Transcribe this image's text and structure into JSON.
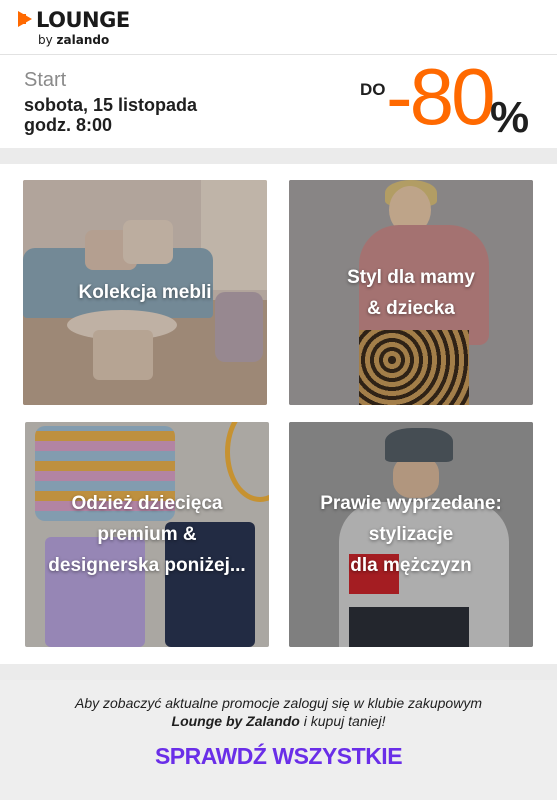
{
  "header": {
    "brand": "LOUNGE",
    "brand_sub_prefix": "by ",
    "brand_sub_name": "zalando",
    "brand_color": "#ff6900"
  },
  "event": {
    "start_label": "Start",
    "date": "sobota, 15 listopada",
    "time": "godz. 8:00",
    "discount_prefix": "DO",
    "discount_value": "-80",
    "discount_unit": "%",
    "accent_color": "#ff6900"
  },
  "tiles": [
    {
      "label": "Kolekcja mebli"
    },
    {
      "label": "Styl dla mamy\n& dziecka"
    },
    {
      "label": "Odzież dziecięca\npremium &\ndesignerska poniżej..."
    },
    {
      "label": "Prawie wyprzedane:\nstylizacje\ndla mężczyzn"
    }
  ],
  "footer": {
    "text_line1": "Aby zobaczyć aktualne promocje zaloguj się w klubie zakupowym",
    "text_line2_bold": "Lounge by Zalando",
    "text_line2_rest": " i kupuj taniej!",
    "cta_label": "SPRAWDŹ WSZYSTKIE",
    "cta_color": "#6a2ee8"
  }
}
